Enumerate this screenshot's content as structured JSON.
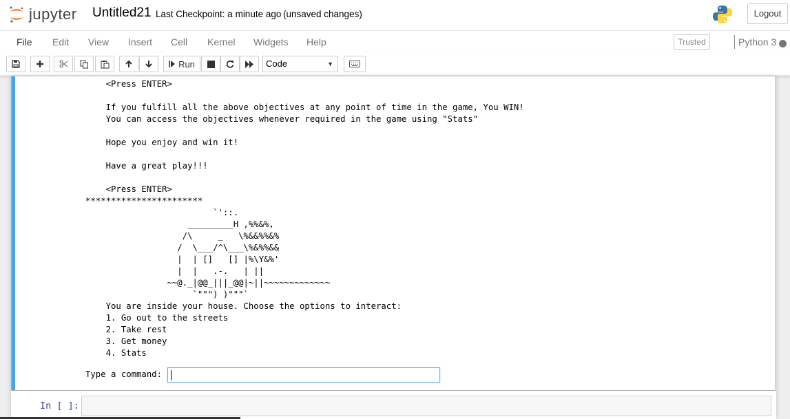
{
  "header": {
    "logo_text": "jupyter",
    "notebook_name": "Untitled21",
    "checkpoint": "Last Checkpoint: a minute ago",
    "autosave_status": "(unsaved changes)",
    "logout_label": "Logout"
  },
  "menubar": {
    "items": [
      "File",
      "Edit",
      "View",
      "Insert",
      "Cell",
      "Kernel",
      "Widgets",
      "Help"
    ],
    "trusted_label": "Trusted",
    "kernel_name": "Python 3"
  },
  "toolbar": {
    "run_label": "Run",
    "cell_type": "Code"
  },
  "output": {
    "lines": [
      "    <Press ENTER>",
      "",
      "    If you fulfill all the above objectives at any point of time in the game, You WIN!",
      "    You can access the objectives whenever required in the game using \"Stats\"",
      "",
      "    Hope you enjoy and win it!",
      "",
      "    Have a great play!!!",
      "",
      "    <Press ENTER>",
      "***********************",
      "                         `'::.",
      "                    _________H ,%%&%,",
      "                   /\\     _   \\%&&%%&%",
      "                  /  \\___/^\\___\\%&%%&&",
      "                  |  | []   [] |%\\Y&%'",
      "                  |  |   .-.   | ||",
      "                ~~@._|@@_|||_@@|~||~~~~~~~~~~~~~",
      "                     `\"\"\") )\"\"\"`",
      "    You are inside your house. Choose the options to interact:",
      "    1. Go out to the streets",
      "    2. Take rest",
      "    3. Get money",
      "    4. Stats"
    ],
    "input_prompt": "Type a command:",
    "input_value": ""
  },
  "next_cell": {
    "prompt": "In [ ]:"
  },
  "colors": {
    "cell_selected_bar": "#42a5f5",
    "prompt_blue": "#303f9f",
    "logo_orange": "#f37726"
  },
  "icons": [
    "save-icon",
    "add-cell-icon",
    "cut-icon",
    "copy-icon",
    "paste-icon",
    "move-up-icon",
    "move-down-icon",
    "run-icon",
    "stop-icon",
    "restart-icon",
    "fast-forward-icon",
    "keyboard-icon",
    "python-logo",
    "kernel-idle-indicator"
  ]
}
